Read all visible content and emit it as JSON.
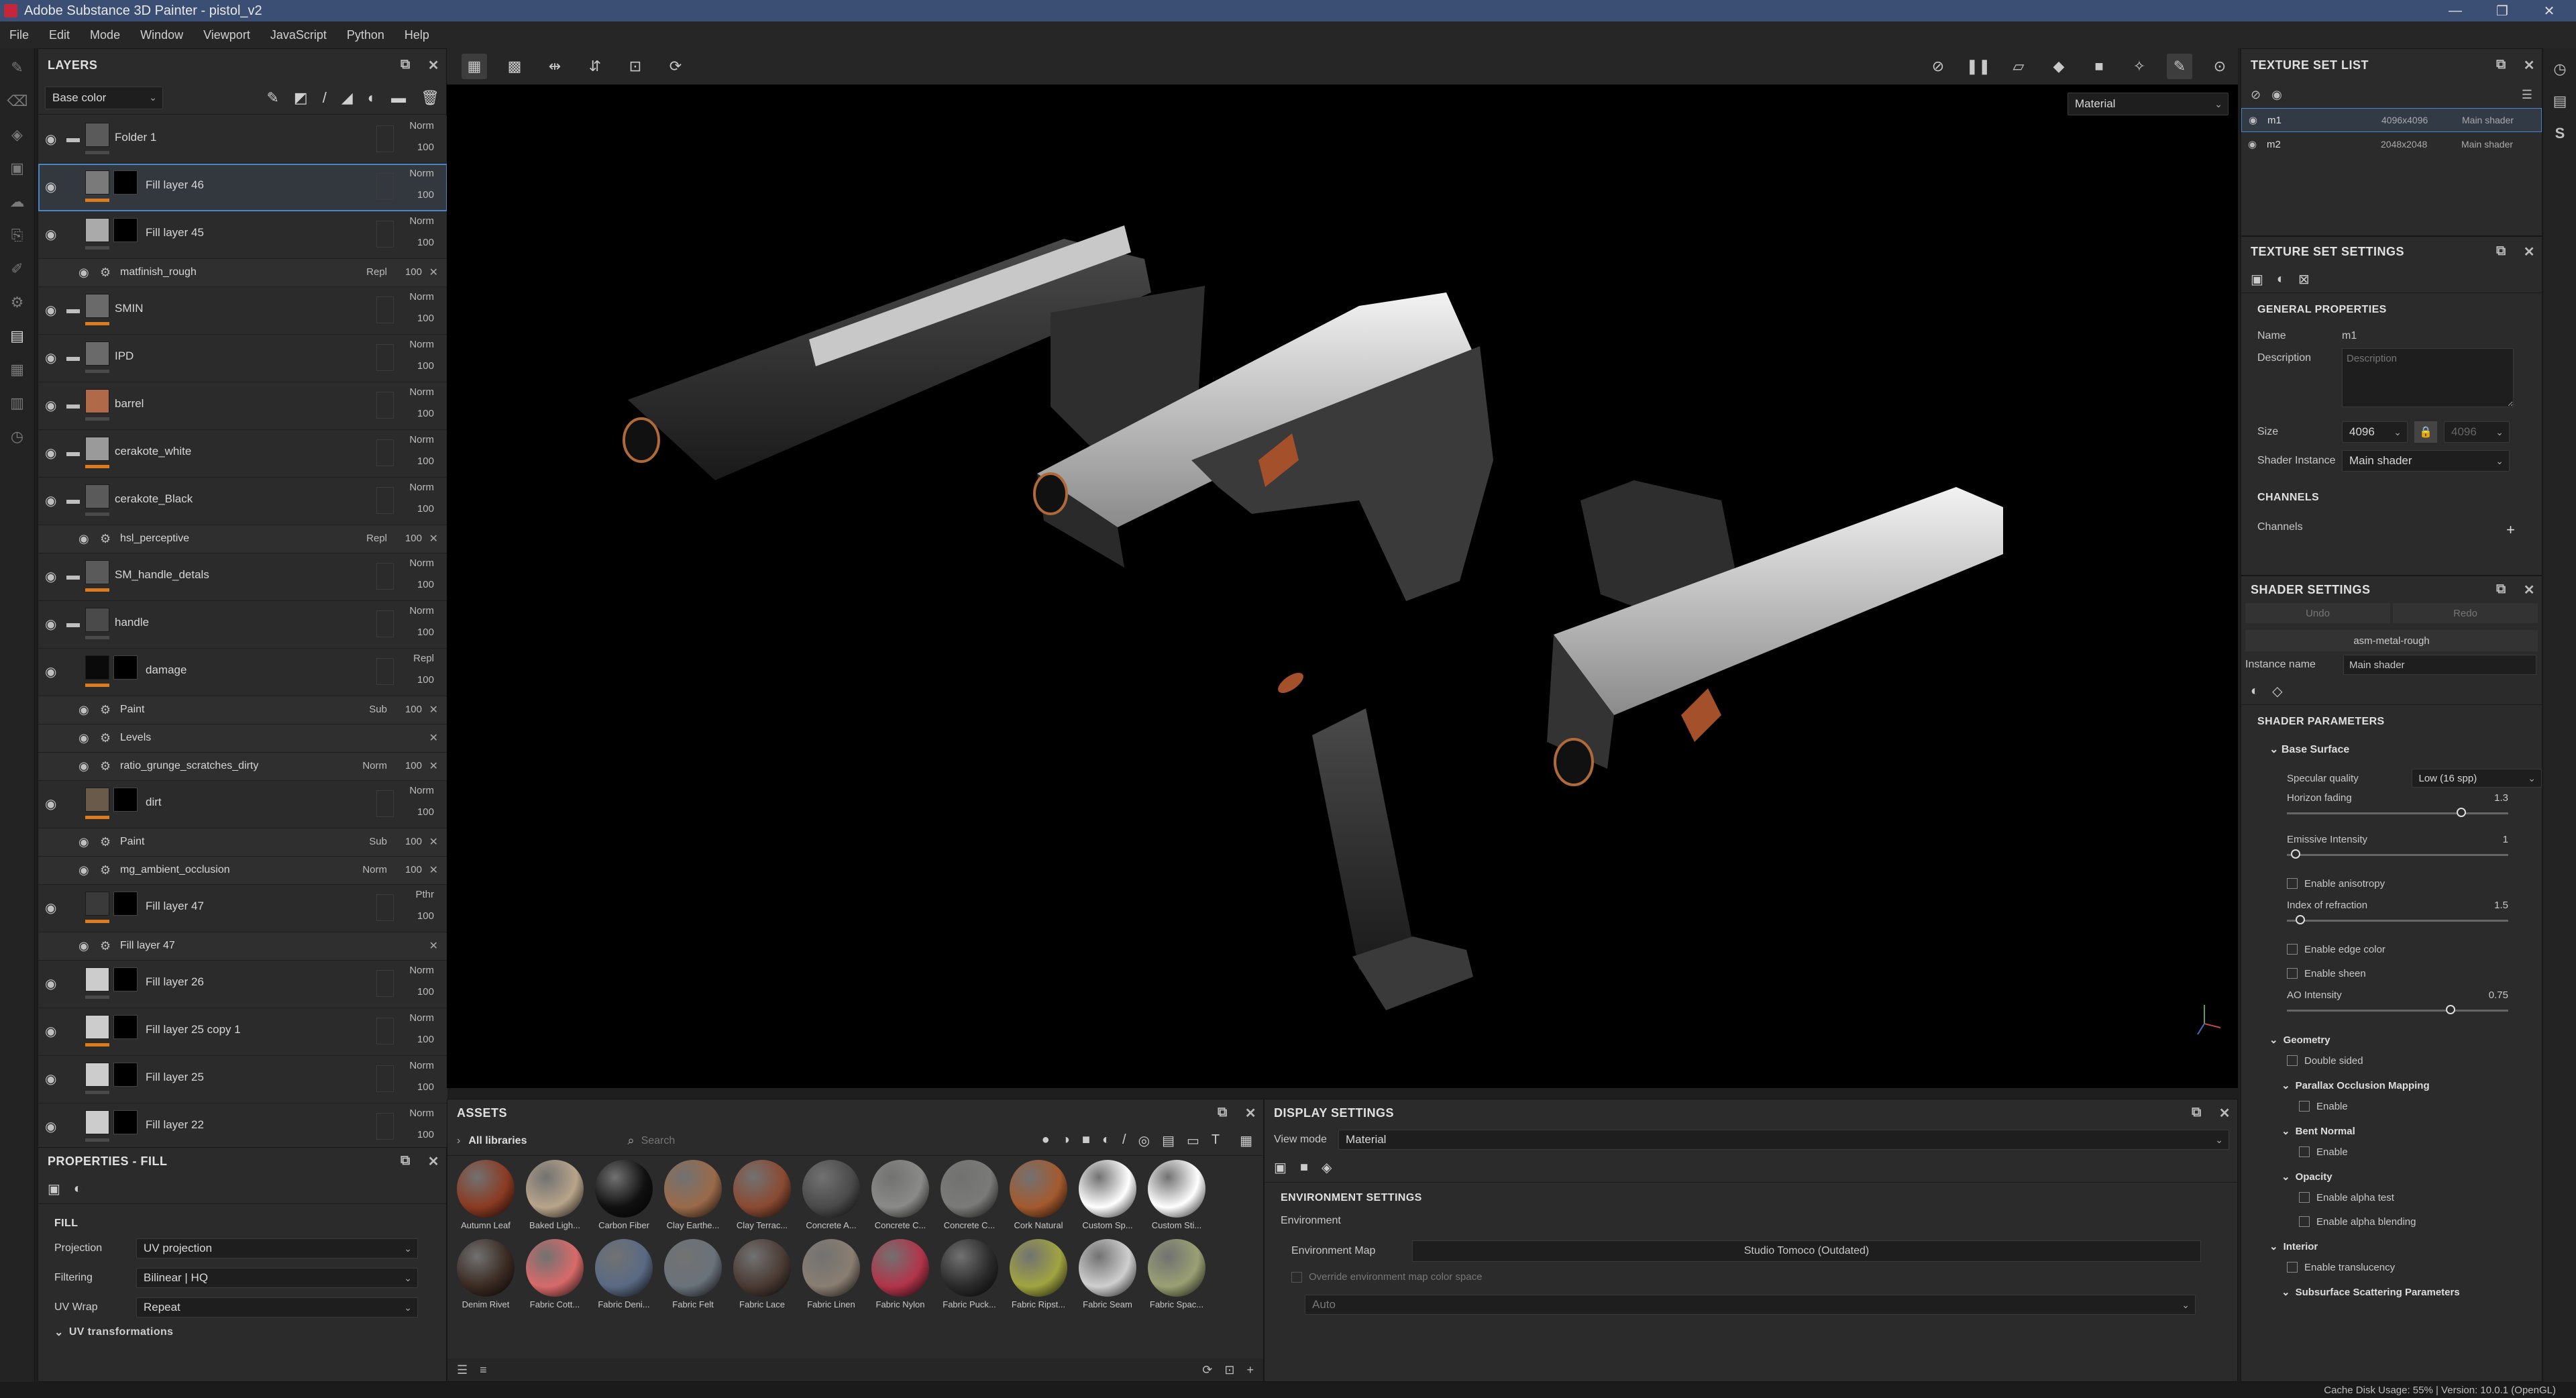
{
  "window": {
    "title": "Adobe Substance 3D Painter - pistol_v2"
  },
  "menu": [
    "File",
    "Edit",
    "Mode",
    "Window",
    "Viewport",
    "JavaScript",
    "Python",
    "Help"
  ],
  "layers": {
    "header": "LAYERS",
    "channel": "Base color",
    "rows": [
      {
        "name": "Folder 1",
        "blend": "Norm",
        "opacity": "100",
        "folder": true
      },
      {
        "name": "Fill layer 46",
        "blend": "Norm",
        "opacity": "100",
        "selected": true
      },
      {
        "name": "Fill layer 45",
        "blend": "Norm",
        "opacity": "100"
      },
      {
        "name": "matfinish_rough",
        "blend": "Repl",
        "opacity": "100",
        "sub": true
      },
      {
        "name": "SMIN",
        "blend": "Norm",
        "opacity": "100",
        "folder": true
      },
      {
        "name": "IPD",
        "blend": "Norm",
        "opacity": "100",
        "folder": true
      },
      {
        "name": "barrel",
        "blend": "Norm",
        "opacity": "100",
        "folder": true
      },
      {
        "name": "cerakote_white",
        "blend": "Norm",
        "opacity": "100",
        "folder": true
      },
      {
        "name": "cerakote_Black",
        "blend": "Norm",
        "opacity": "100",
        "folder": true
      },
      {
        "name": "hsl_perceptive",
        "blend": "Repl",
        "opacity": "100",
        "sub": true
      },
      {
        "name": "SM_handle_detals",
        "blend": "Norm",
        "opacity": "100",
        "folder": true
      },
      {
        "name": "handle",
        "blend": "Norm",
        "opacity": "100",
        "folder": true
      },
      {
        "name": "damage",
        "blend": "Repl",
        "opacity": "100"
      },
      {
        "name": "Paint",
        "blend": "Sub",
        "opacity": "100",
        "sub": true
      },
      {
        "name": "Levels",
        "blend": "",
        "opacity": "",
        "sub": true
      },
      {
        "name": "ratio_grunge_scratches_dirty",
        "blend": "Norm",
        "opacity": "100",
        "sub": true
      },
      {
        "name": "dirt",
        "blend": "Norm",
        "opacity": "100"
      },
      {
        "name": "Paint",
        "blend": "Sub",
        "opacity": "100",
        "sub": true
      },
      {
        "name": "mg_ambient_occlusion",
        "blend": "Norm",
        "opacity": "100",
        "sub": true
      },
      {
        "name": "Fill layer 47",
        "blend": "Pthr",
        "opacity": "100"
      },
      {
        "name": "Fill layer 47",
        "blend": "",
        "opacity": "",
        "sub": true
      },
      {
        "name": "Fill layer 26",
        "blend": "Norm",
        "opacity": "100"
      },
      {
        "name": "Fill layer 25 copy 1",
        "blend": "Norm",
        "opacity": "100"
      },
      {
        "name": "Fill layer 25",
        "blend": "Norm",
        "opacity": "100"
      },
      {
        "name": "Fill layer 22",
        "blend": "Norm",
        "opacity": "100"
      }
    ]
  },
  "properties": {
    "header": "PROPERTIES - FILL",
    "section": "FILL",
    "projection_label": "Projection",
    "projection": "UV projection",
    "filtering_label": "Filtering",
    "filtering": "Bilinear | HQ",
    "uvwrap_label": "UV Wrap",
    "uvwrap": "Repeat",
    "uvtrans": "UV transformations"
  },
  "viewport": {
    "mode": "Material"
  },
  "assets": {
    "header": "ASSETS",
    "library": "All libraries",
    "search_placeholder": "Search",
    "row1": [
      "Autumn Leaf",
      "Baked Ligh...",
      "Carbon Fiber",
      "Clay Earthe...",
      "Clay Terrac...",
      "Concrete A...",
      "Concrete C...",
      "Concrete C...",
      "Cork Natural",
      "Custom Sp...",
      "Custom Sti..."
    ],
    "row2": [
      "Denim Rivet",
      "Fabric Cott...",
      "Fabric Deni...",
      "Fabric Felt",
      "Fabric Lace",
      "Fabric Linen",
      "Fabric Nylon",
      "Fabric Puck...",
      "Fabric Ripst...",
      "Fabric Seam",
      "Fabric Spac..."
    ],
    "colors1": [
      "#8a3a22",
      "#b8a48a",
      "#101010",
      "#9a6a4a",
      "#8a4a32",
      "#4a4a4a",
      "#8a8a88",
      "#7a7a78",
      "#a45a2e",
      "#ffffff",
      "#ffffff"
    ],
    "colors2": [
      "#3a2a22",
      "#d86a6a",
      "#5a6a84",
      "#6a727a",
      "#4a3a34",
      "#8a7e72",
      "#b2344a",
      "#2a2a2a",
      "#a0a440",
      "#cfcfcf",
      "#9aa074"
    ]
  },
  "display": {
    "header": "DISPLAY SETTINGS",
    "view_mode_label": "View mode",
    "view_mode": "Material",
    "env_section": "ENVIRONMENT SETTINGS",
    "env_label": "Environment",
    "env_map_label": "Environment Map",
    "env_map": "Studio Tomoco (Outdated)",
    "override": "Override environment map color space",
    "auto": "Auto"
  },
  "texture_set_list": {
    "header": "TEXTURE SET LIST",
    "items": [
      {
        "name": "m1",
        "res": "4096x4096",
        "shader": "Main shader"
      },
      {
        "name": "m2",
        "res": "2048x2048",
        "shader": "Main shader"
      }
    ]
  },
  "texture_set_settings": {
    "header": "TEXTURE SET SETTINGS",
    "general": "GENERAL PROPERTIES",
    "name_label": "Name",
    "name": "m1",
    "desc_label": "Description",
    "desc_placeholder": "Description",
    "size_label": "Size",
    "size": "4096",
    "size2": "4096",
    "shader_label": "Shader Instance",
    "shader": "Main shader",
    "channels_section": "CHANNELS",
    "channels_label": "Channels"
  },
  "shader_settings": {
    "header": "SHADER SETTINGS",
    "undo": "Undo",
    "redo": "Redo",
    "shader_name": "asm-metal-rough",
    "instance_label": "Instance name",
    "instance": "Main shader",
    "params": "SHADER PARAMETERS",
    "base_surface": "Base Surface",
    "spec_label": "Specular quality",
    "spec": "Low (16 spp)",
    "horizon_label": "Horizon fading",
    "horizon": "1.3",
    "horizon_frac": 0.8,
    "emissive_label": "Emissive Intensity",
    "emissive": "1",
    "emissive_frac": 0.02,
    "aniso": "Enable anisotropy",
    "ior_label": "Index of refraction",
    "ior": "1.5",
    "ior_frac": 0.04,
    "edge": "Enable edge color",
    "sheen": "Enable sheen",
    "ao_label": "AO Intensity",
    "ao": "0.75",
    "ao_frac": 0.75,
    "geometry": "Geometry",
    "double_sided": "Double sided",
    "pom": "Parallax Occlusion Mapping",
    "enable": "Enable",
    "bent": "Bent Normal",
    "opacity": "Opacity",
    "alpha_test": "Enable alpha test",
    "alpha_blend": "Enable alpha blending",
    "interior": "Interior",
    "translucency": "Enable translucency",
    "sss": "Subsurface Scattering Parameters"
  },
  "status": {
    "text": "Cache Disk Usage:   55% | Version: 10.0.1 (OpenGL)"
  }
}
